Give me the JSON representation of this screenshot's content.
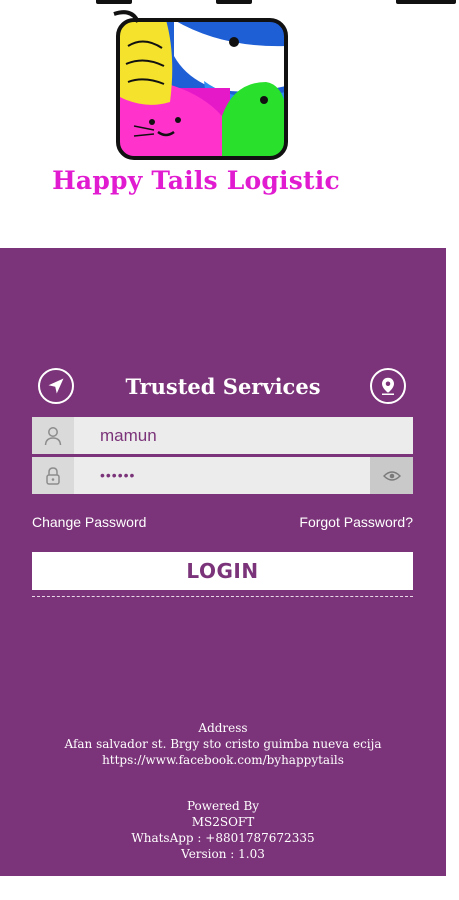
{
  "brand": {
    "title": "Happy Tails Logistic"
  },
  "hero": {
    "title": "Trusted Services"
  },
  "login_form": {
    "username_value": "mamun",
    "password_value": "••••••"
  },
  "links": {
    "change_password": "Change Password",
    "forgot_password": "Forgot Password?"
  },
  "login_button": {
    "label": "LOGIN"
  },
  "address": {
    "heading": "Address",
    "line": "Afan salvador st. Brgy sto cristo guimba nueva ecija",
    "facebook": "https://www.facebook.com/byhappytails"
  },
  "footer": {
    "powered_by": "Powered By",
    "company": "MS2SOFT",
    "whatsapp": "WhatsApp : +8801787672335",
    "version": "Version : 1.03"
  },
  "colors": {
    "panel": "#7b3479",
    "brand_text": "#e01bd0",
    "field_background": "#ececec"
  },
  "icons": {
    "hero_left": "send-icon",
    "hero_right": "location-pin-icon",
    "username": "user-icon",
    "password": "lock-icon",
    "toggle_password": "eye-icon"
  }
}
